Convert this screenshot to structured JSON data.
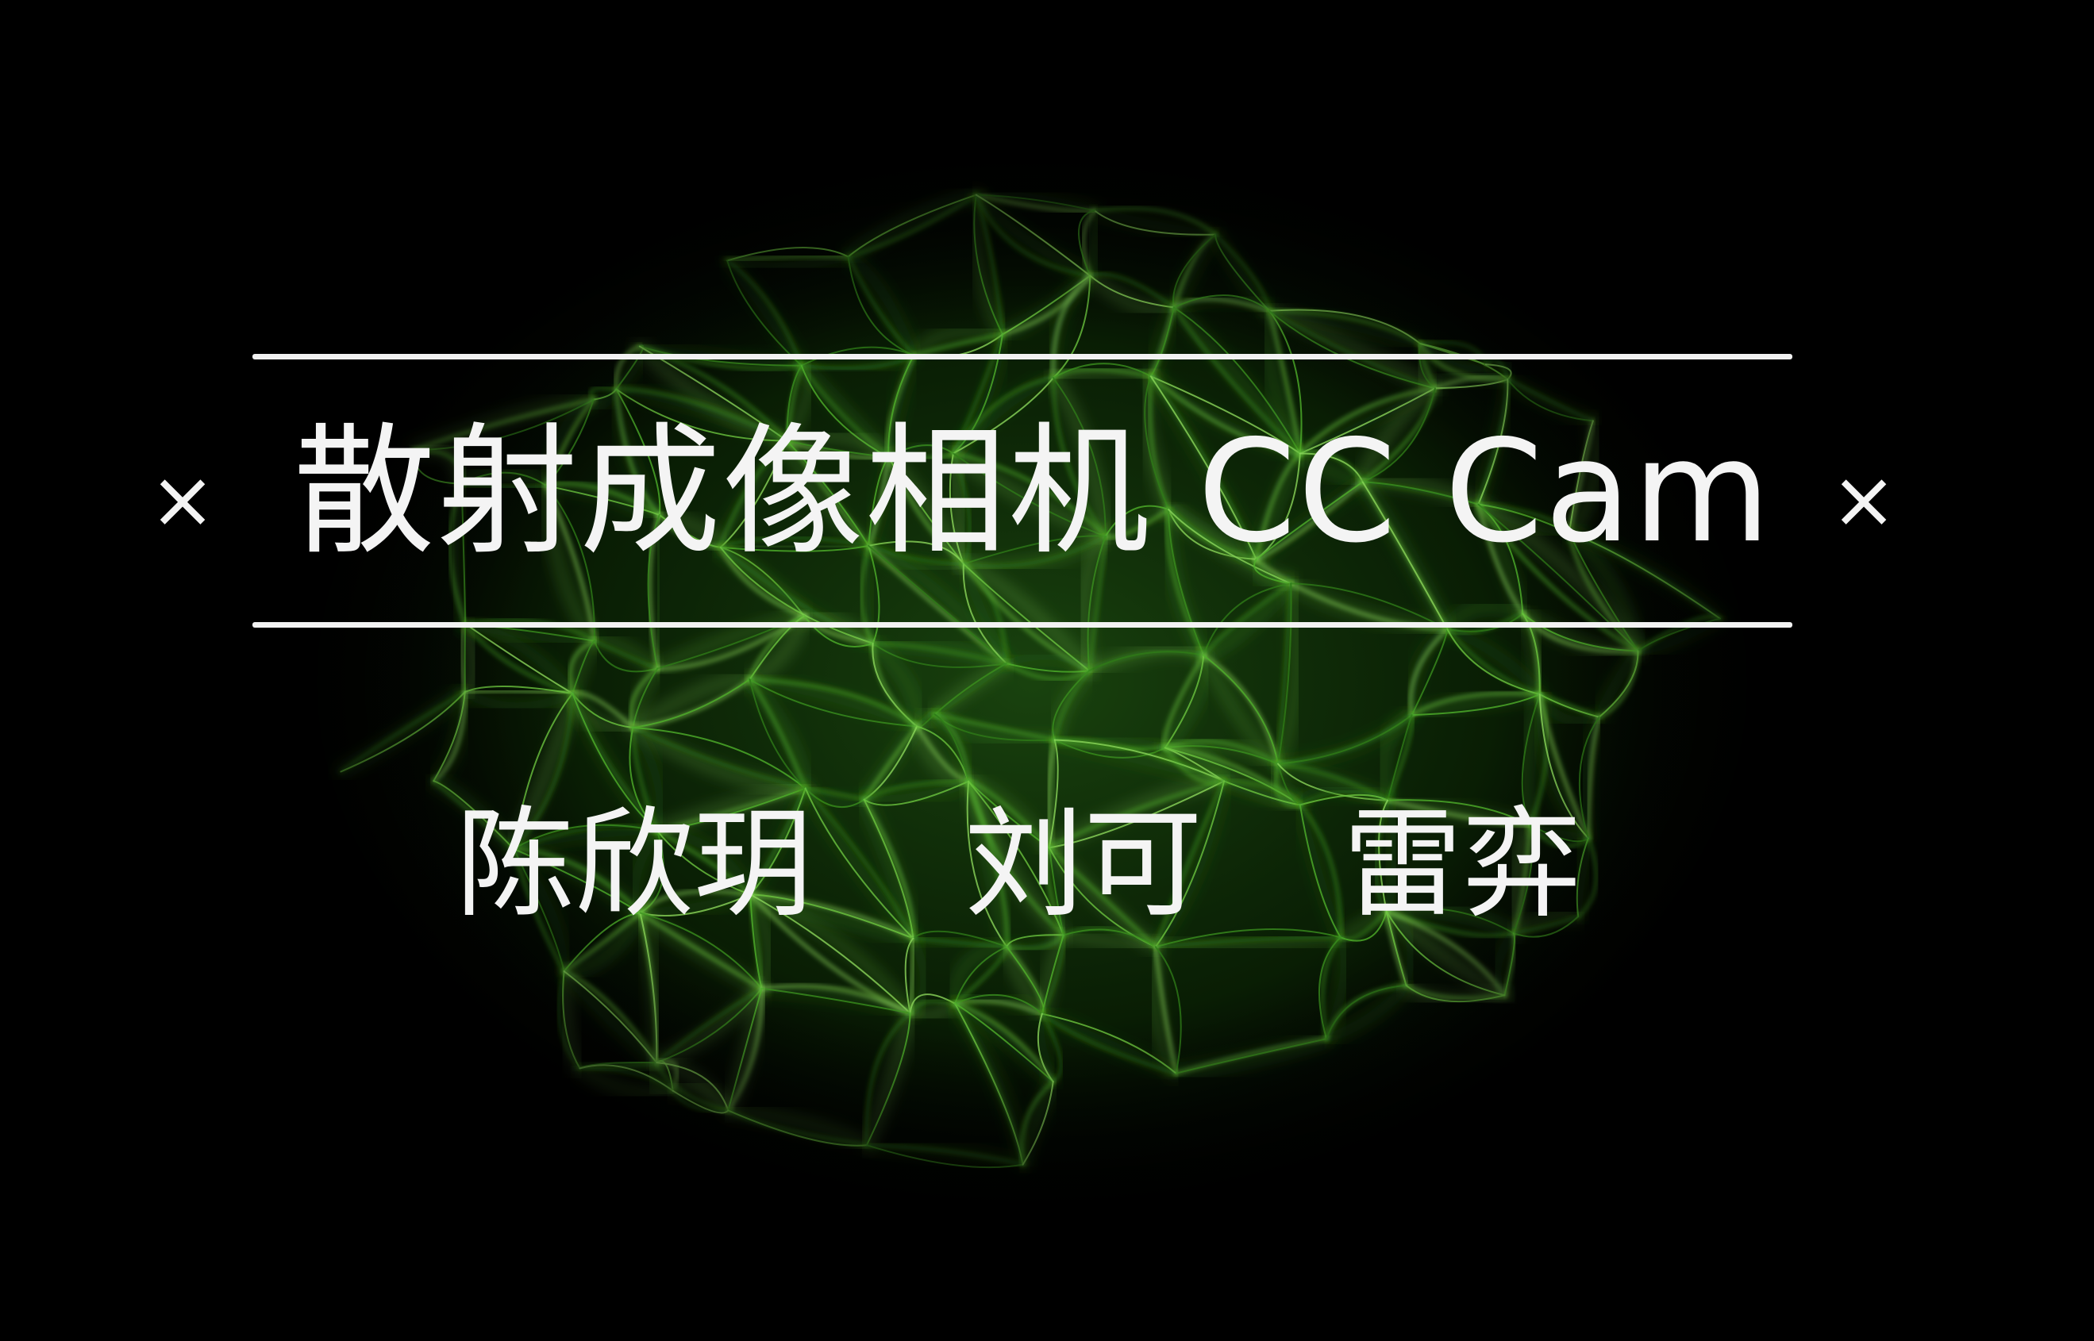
{
  "slide": {
    "title": "散射成像相机 CC Cam",
    "left_mark": "×",
    "right_mark": "×",
    "authors": [
      "陈欣玥",
      "刘可",
      "雷弈"
    ]
  },
  "icons": {
    "left_mark_icon": "close-icon",
    "right_mark_icon": "close-icon"
  },
  "colors": {
    "background": "#000000",
    "caustic_green": "#3fa020",
    "text": "#f4f4f4"
  }
}
